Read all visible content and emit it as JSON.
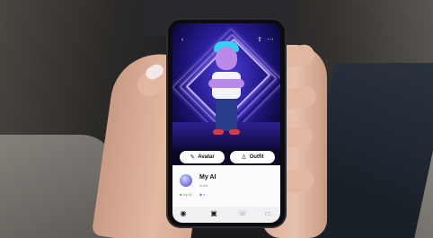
{
  "phone_screen": {
    "header_icons": {
      "back": "‹",
      "share": "⇪",
      "more": "⋯"
    },
    "buttons": {
      "avatar_label": "Avatar",
      "outfit_label": "Outfit",
      "avatar_icon": "✎",
      "outfit_icon": "♙"
    },
    "chat": {
      "name": "My AI",
      "subtitle": "Invite",
      "stat1": "■ My AI",
      "stat2": "◆ 4"
    },
    "nav_icons": {
      "camera": "◉",
      "chat": "▣",
      "call": "☏",
      "video": "▭"
    },
    "colors": {
      "background_glow": "#4f3fd6",
      "neon": "#a78bff",
      "avatar_hair": "#34d2f2"
    }
  }
}
